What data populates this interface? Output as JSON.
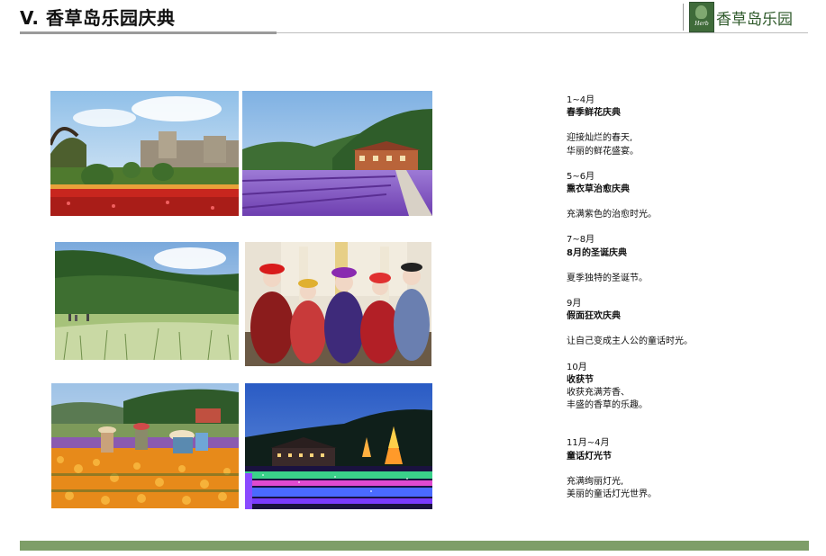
{
  "header": {
    "title": "V. 香草岛乐园庆典",
    "brand_name": "香草岛乐园",
    "logo_text": "Herb"
  },
  "photos": [
    {
      "subject": "flower-garden-topiary"
    },
    {
      "subject": "lavender-field"
    },
    {
      "subject": "green-hills-herb-field"
    },
    {
      "subject": "carnival-costumes"
    },
    {
      "subject": "marigold-field-gardeners"
    },
    {
      "subject": "night-light-festival"
    }
  ],
  "events": [
    {
      "period": "1~4月",
      "name": "春季鲜花庆典",
      "desc": "迎接灿烂的春天,\n华丽的鲜花盛宴。"
    },
    {
      "period": "5~6月",
      "name": "熏衣草治愈庆典",
      "desc": "充满紫色的治愈时光。"
    },
    {
      "period": "7~8月",
      "name": "8月的圣诞庆典",
      "desc": "夏季独特的圣诞节。"
    },
    {
      "period": "9月",
      "name": "假面狂欢庆典",
      "desc": "让自己变成主人公的童话时光。"
    },
    {
      "period": "10月",
      "name": "收获节",
      "desc": "收获充满芳香、\n丰盛的香草的乐趣。"
    },
    {
      "period": "11月~4月",
      "name": "童话灯光节",
      "desc": "充满绚丽灯光,\n美丽的童话灯光世界。"
    }
  ],
  "colors": {
    "footer": "#7e9e68",
    "brand_green": "#2f5a2b"
  }
}
